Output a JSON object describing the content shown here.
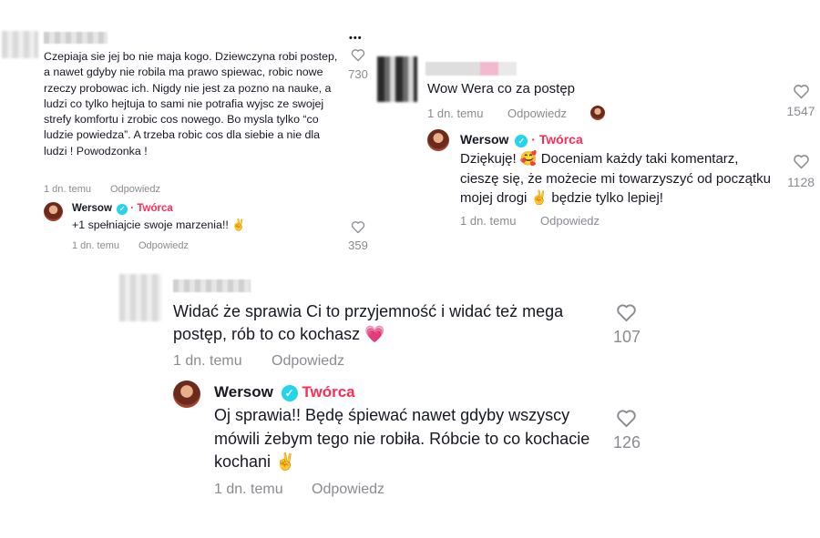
{
  "panel_a": {
    "comment": "Czepiaja sie jej bo nie maja kogo. Dziewczyna robi postep, a nawet gdyby nie robila ma prawo spiewac, robic nowe rzeczy probowac ich. Nigdy nie jest za pozno na nauke, a ludzi co tylko hejtuja to sami nie potrafia wyjsc ze swojej strefy komfortu i zrobic cos nowego. Bo mysla tylko “co ludzie powiedza”. A trzeba robic cos dla siebie a nie dla ludzi ! Powodzonka !",
    "time": "1 dn. temu",
    "reply_label": "Odpowiedz",
    "likes": "730",
    "more": "•••",
    "reply": {
      "author": "Wersow",
      "creator": "· Twórca",
      "text": "+1 spełniajcie swoje marzenia!! ✌️",
      "time": "1 dn. temu",
      "reply_label": "Odpowiedz",
      "likes": "359"
    }
  },
  "panel_b": {
    "comment": "Wow Wera co za postęp",
    "time": "1 dn. temu",
    "reply_label": "Odpowiedz",
    "likes": "1547",
    "reply": {
      "author": "Wersow",
      "creator": "· Twórca",
      "text": "Dziękuję! 🥰 Doceniam każdy taki komentarz, cieszę się, że możecie mi towarzyszyć od początku mojej drogi ✌️ będzie tylko lepiej!",
      "time": "1 dn. temu",
      "reply_label": "Odpowiedz",
      "likes": "1128"
    }
  },
  "panel_c": {
    "comment": "Widać że sprawia Ci to przyjemność i widać też mega postęp, rób to co kochasz 💗",
    "time": "1 dn. temu",
    "reply_label": "Odpowiedz",
    "likes": "107",
    "reply": {
      "author": "Wersow",
      "creator": "Twórca",
      "text": "Oj sprawia!! Będę śpiewać nawet gdyby wszyscy mówili żebym tego nie robiła. Róbcie to co kochacie kochani ✌️",
      "time": "1 dn. temu",
      "reply_label": "Odpowiedz",
      "likes": "126"
    }
  },
  "colors": {
    "creator": "#fe2c55",
    "verified": "#20d5ec",
    "meta": "#8a8b91"
  },
  "icons": [
    "heart-icon",
    "verified-icon",
    "more-icon"
  ]
}
